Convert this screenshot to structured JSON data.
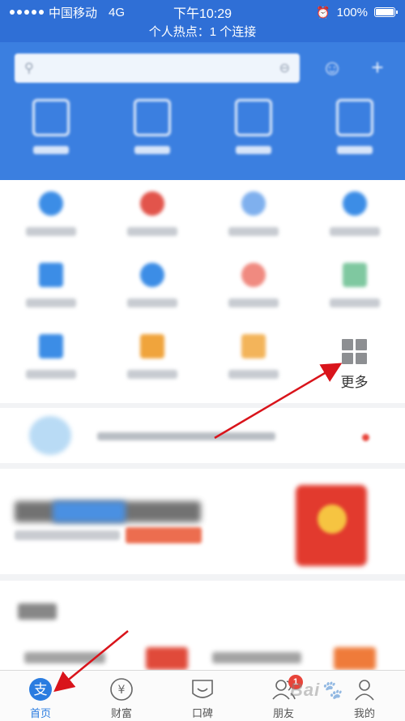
{
  "status_bar": {
    "carrier": "中国移动",
    "network": "4G",
    "time": "下午10:29",
    "battery": "100%"
  },
  "hotspot_banner": "个人热点：1 个连接",
  "grid": {
    "more_label": "更多"
  },
  "tabbar": {
    "tabs": [
      {
        "label": "首页",
        "icon": "alipay-icon",
        "active": true
      },
      {
        "label": "财富",
        "icon": "yen-icon"
      },
      {
        "label": "口碑",
        "icon": "koubei-icon"
      },
      {
        "label": "朋友",
        "icon": "friends-icon",
        "badge": "1"
      },
      {
        "label": "我的",
        "icon": "person-icon"
      }
    ]
  },
  "colors": {
    "header_blue": "#3b7fe0",
    "accent_blue": "#2a7ce0",
    "annotation_red": "#d9141b"
  }
}
